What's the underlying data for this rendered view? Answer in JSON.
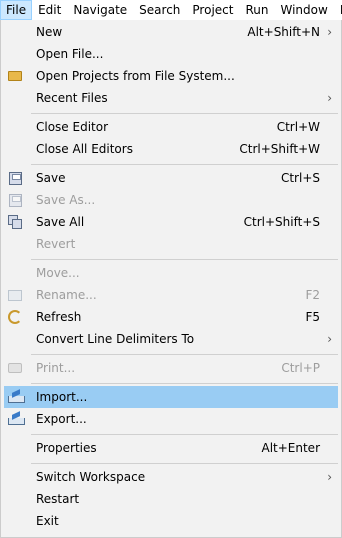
{
  "menubar": [
    {
      "label": "File",
      "active": true
    },
    {
      "label": "Edit"
    },
    {
      "label": "Navigate"
    },
    {
      "label": "Search"
    },
    {
      "label": "Project"
    },
    {
      "label": "Run"
    },
    {
      "label": "Window"
    },
    {
      "label": "He"
    }
  ],
  "file_menu": {
    "new": {
      "label": "New",
      "accel": "Alt+Shift+N",
      "submenu_arrow": "›"
    },
    "open_file": {
      "label": "Open File..."
    },
    "open_projects": {
      "label": "Open Projects from File System...",
      "icon": "folder-icon"
    },
    "recent_files": {
      "label": "Recent Files",
      "submenu_arrow": "›"
    },
    "close_editor": {
      "label": "Close Editor",
      "accel": "Ctrl+W"
    },
    "close_all_editors": {
      "label": "Close All Editors",
      "accel": "Ctrl+Shift+W"
    },
    "save": {
      "label": "Save",
      "accel": "Ctrl+S",
      "icon": "save-icon"
    },
    "save_as": {
      "label": "Save As...",
      "icon": "save-as-icon",
      "disabled": true
    },
    "save_all": {
      "label": "Save All",
      "accel": "Ctrl+Shift+S",
      "icon": "save-all-icon"
    },
    "revert": {
      "label": "Revert",
      "disabled": true
    },
    "move": {
      "label": "Move...",
      "disabled": true
    },
    "rename": {
      "label": "Rename...",
      "accel": "F2",
      "icon": "rename-icon",
      "disabled": true
    },
    "refresh": {
      "label": "Refresh",
      "accel": "F5",
      "icon": "refresh-icon"
    },
    "convert_line_delimiters": {
      "label": "Convert Line Delimiters To",
      "submenu_arrow": "›"
    },
    "print": {
      "label": "Print...",
      "accel": "Ctrl+P",
      "icon": "print-icon",
      "disabled": true
    },
    "import": {
      "label": "Import...",
      "icon": "import-icon",
      "highlighted": true
    },
    "export": {
      "label": "Export...",
      "icon": "export-icon"
    },
    "properties": {
      "label": "Properties",
      "accel": "Alt+Enter"
    },
    "switch_workspace": {
      "label": "Switch Workspace",
      "submenu_arrow": "›"
    },
    "restart": {
      "label": "Restart"
    },
    "exit": {
      "label": "Exit"
    }
  },
  "colors": {
    "highlight": "#99ccf3",
    "menu_background": "#f2f2f2",
    "disabled_text": "#9d9d9d"
  }
}
